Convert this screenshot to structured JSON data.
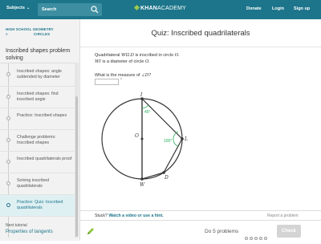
{
  "topbar": {
    "subjects_label": "Subjects",
    "search_placeholder": "Search",
    "logo_prefix": "KHAN",
    "logo_suffix": "ACADEMY",
    "donate": "Donate",
    "login": "Login",
    "signup": "Sign up",
    "bg_color": "#1c758a"
  },
  "sidebar": {
    "crumb_course": "HIGH SCHOOL GEOMETRY",
    "crumb_separator": ">",
    "crumb_unit": "CIRCLES",
    "title": "Inscribed shapes problem solving",
    "items": [
      {
        "label": "Inscribed shapes: angle subtended by diameter",
        "icon": "video-icon"
      },
      {
        "label": "Inscribed shapes: find inscribed angle",
        "icon": "video-icon"
      },
      {
        "label": "Practice: Inscribed shapes",
        "icon": "practice-icon"
      },
      {
        "label": "Challenge problems: Inscribed shapes",
        "icon": "article-icon"
      },
      {
        "label": "Inscribed quadrilaterals proof",
        "icon": "video-icon"
      },
      {
        "label": "Solving inscribed quadrilaterals",
        "icon": "video-icon"
      },
      {
        "label": "Practice: Quiz: Inscribed quadrilaterals",
        "icon": "practice-icon",
        "active": true
      }
    ],
    "next_label": "Next tutorial",
    "next_link": "Properties of tangents"
  },
  "quiz": {
    "title": "Quiz: Inscribed quadrilaterals",
    "line1_a": "Quadrilateral",
    "line1_var": "WILD",
    "line1_b": "is inscribed in circle",
    "line1_circle": "O.",
    "line2_var": "WI",
    "line2_b": "is a diameter of circle",
    "line2_circle": "O.",
    "question_a": "What is the measure of",
    "question_angle": "∠D?",
    "answer_value": "",
    "degree_symbol": "°"
  },
  "figure": {
    "points": {
      "I": "I",
      "L": "L",
      "D": "D",
      "W": "W",
      "O": "O"
    },
    "angle_I": "45°",
    "angle_L": "100°",
    "accent_color": "#1fab54"
  },
  "footer": {
    "stuck_label": "Stuck?",
    "hint_link": "Watch a video or use a hint.",
    "report": "Report a problem",
    "progress": "Do 5 problems",
    "check": "Check"
  }
}
